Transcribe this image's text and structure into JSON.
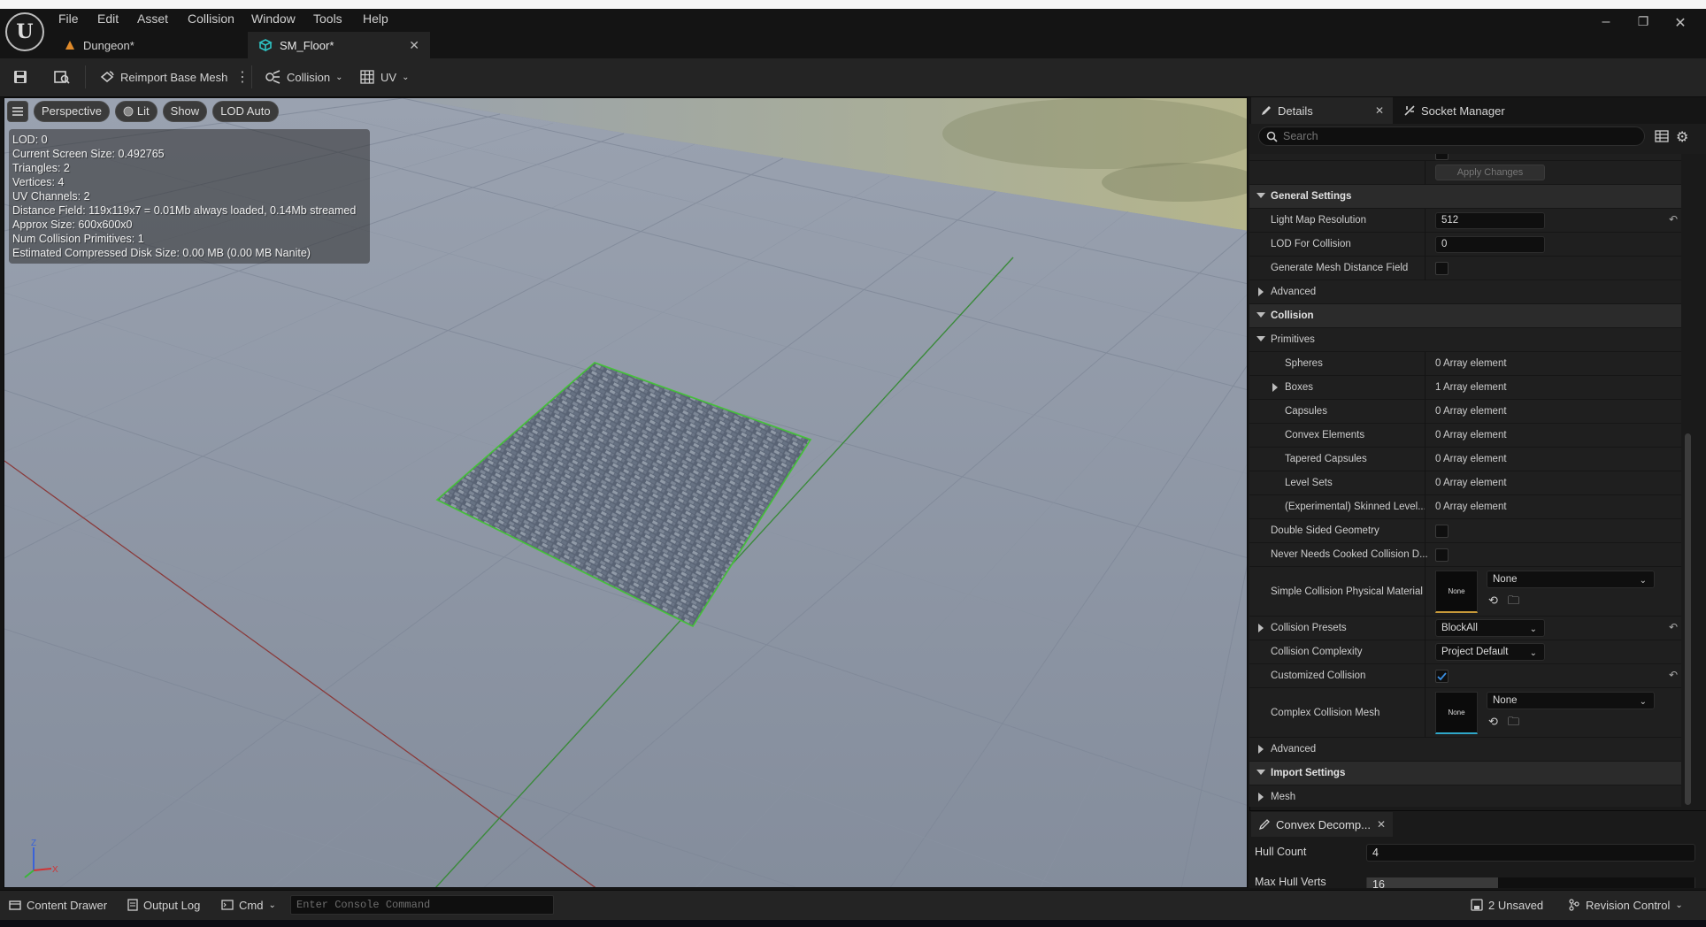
{
  "menu": [
    "File",
    "Edit",
    "Asset",
    "Collision",
    "Window",
    "Tools",
    "Help"
  ],
  "doc_tabs": {
    "dungeon": "Dungeon*",
    "floor": "SM_Floor*"
  },
  "toolbar": {
    "reimport": "Reimport Base Mesh",
    "collision": "Collision",
    "uv": "UV"
  },
  "viewport": {
    "perspective": "Perspective",
    "lit": "Lit",
    "show": "Show",
    "lod": "LOD Auto",
    "stats": [
      "LOD:  0",
      "Current Screen Size:  0.492765",
      "Triangles:  2",
      "Vertices:  4",
      "UV Channels:  2",
      "Distance Field:  119x119x7 = 0.01Mb always loaded, 0.14Mb streamed",
      "Approx Size: 600x600x0",
      "Num Collision Primitives:  1",
      "Estimated Compressed Disk Size: 0.00 MB (0.00 MB Nanite)"
    ]
  },
  "panel_tabs": {
    "details": "Details",
    "socket": "Socket Manager"
  },
  "search": {
    "placeholder": "Search"
  },
  "details": {
    "apply": "Apply Changes",
    "general_settings": "General Settings",
    "light_map_resolution": "Light Map Resolution",
    "light_map_value": "512",
    "lod_for_collision": "LOD For Collision",
    "lod_for_collision_value": "0",
    "generate_df": "Generate Mesh Distance Field",
    "advanced": "Advanced",
    "collision": "Collision",
    "primitives": "Primitives",
    "spheres": "Spheres",
    "spheres_val": "0 Array element",
    "boxes": "Boxes",
    "boxes_val": "1 Array element",
    "capsules": "Capsules",
    "capsules_val": "0 Array element",
    "convex": "Convex Elements",
    "convex_val": "0 Array element",
    "tapered": "Tapered Capsules",
    "tapered_val": "0 Array element",
    "level_sets": "Level Sets",
    "level_sets_val": "0 Array element",
    "skinned": "(Experimental) Skinned Level...",
    "skinned_val": "0 Array element",
    "double_sided": "Double Sided Geometry",
    "never_cooked": "Never Needs Cooked Collision D...",
    "simple_phys_mat": "Simple Collision Physical Material",
    "none": "None",
    "collision_presets": "Collision Presets",
    "presets_val": "BlockAll",
    "collision_complexity": "Collision Complexity",
    "complexity_val": "Project Default",
    "customized_collision": "Customized Collision",
    "complex_collision_mesh": "Complex Collision Mesh",
    "advanced2": "Advanced",
    "import_settings": "Import Settings",
    "mesh": "Mesh"
  },
  "convex_panel": {
    "title": "Convex Decomp...",
    "hull_count_label": "Hull Count",
    "hull_count": "4",
    "max_hull_verts_label": "Max Hull Verts",
    "max_hull_verts": "16"
  },
  "statusbar": {
    "content_drawer": "Content Drawer",
    "output_log": "Output Log",
    "cmd": "Cmd",
    "console_placeholder": "Enter Console Command",
    "unsaved": "2 Unsaved",
    "revision": "Revision Control"
  },
  "colors": {
    "accent_blue": "#2f7cd6",
    "selection_green": "#49c23f",
    "grid_red": "#8a3a3a",
    "grid_green": "#3b8a3b"
  }
}
